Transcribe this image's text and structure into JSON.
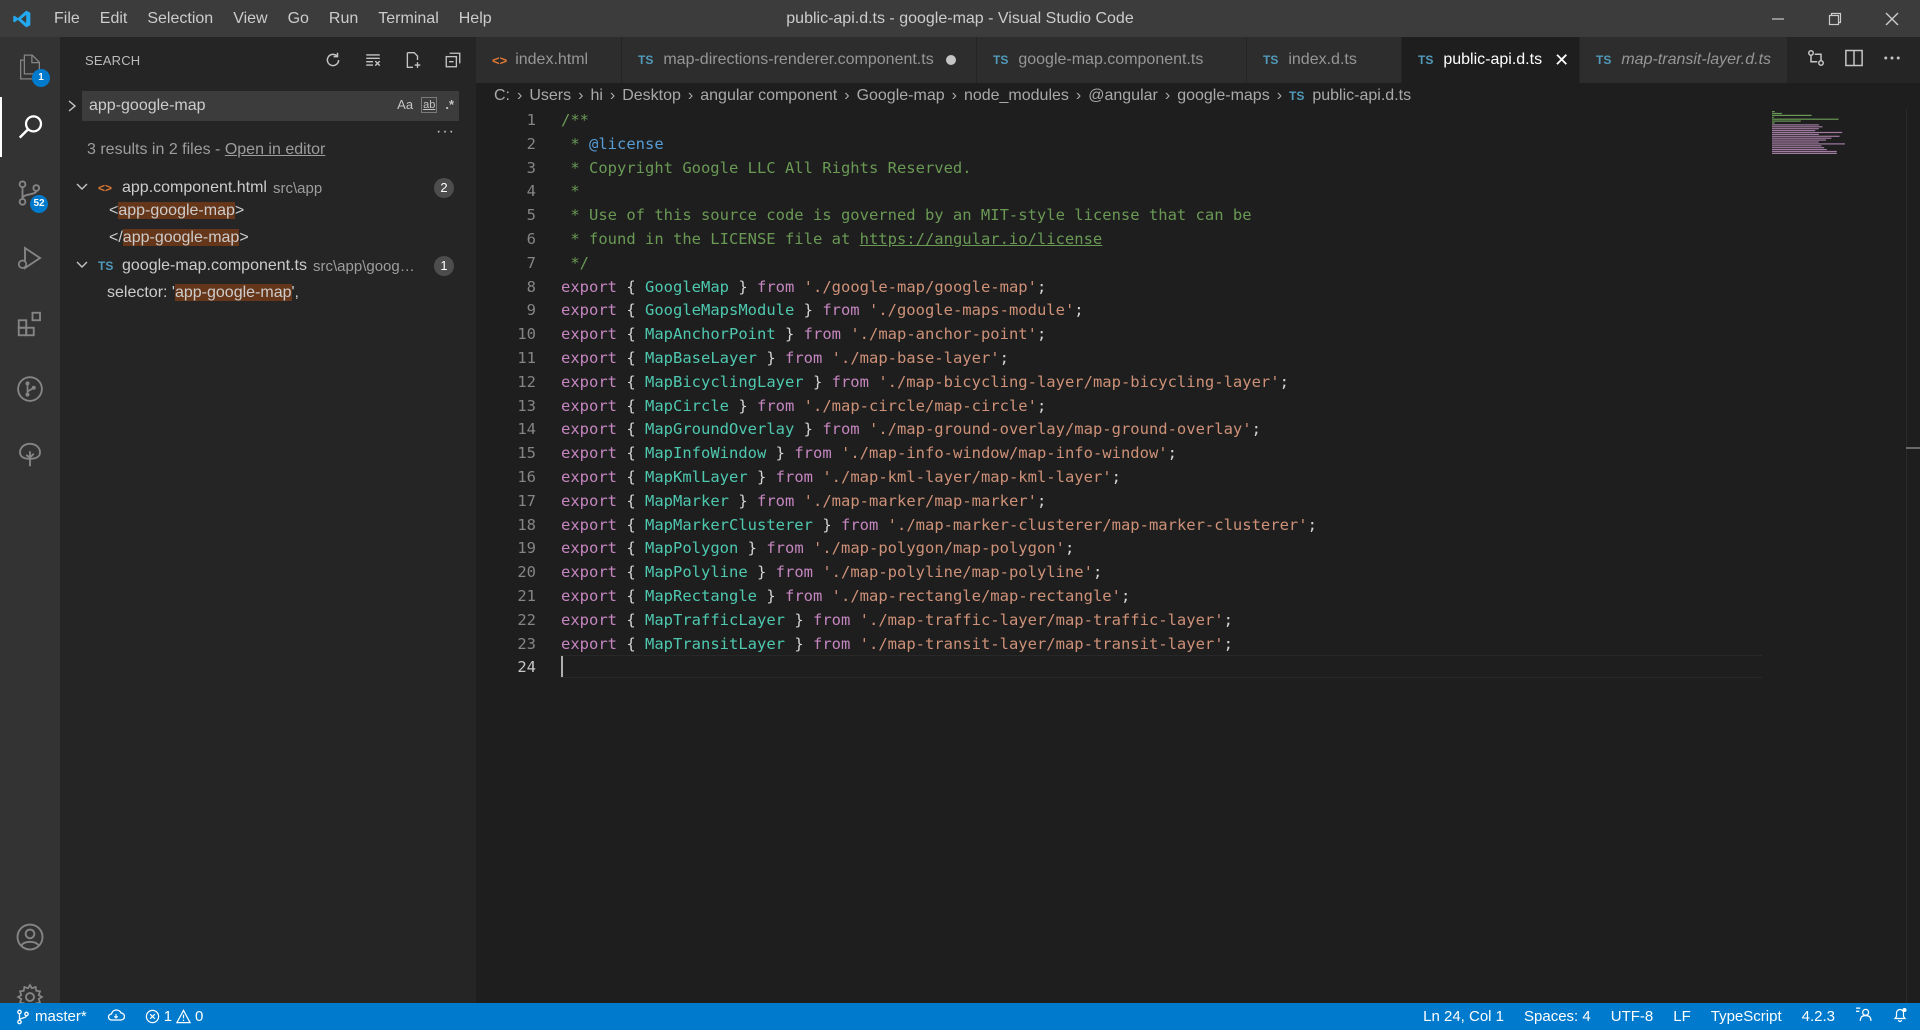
{
  "window": {
    "title": "public-api.d.ts - google-map - Visual Studio Code"
  },
  "menu": [
    "File",
    "Edit",
    "Selection",
    "View",
    "Go",
    "Run",
    "Terminal",
    "Help"
  ],
  "activity_bar": {
    "source_control_badge": "52",
    "explorer_badge": "1"
  },
  "sidebar": {
    "title": "SEARCH",
    "search_value": "app-google-map",
    "options": {
      "match_case": "Aa",
      "whole_word": "ab",
      "regex": ".*"
    },
    "summary_prefix": "3 results in 2 files - ",
    "summary_link": "Open in editor",
    "files": [
      {
        "icon": "<>",
        "name": "app.component.html",
        "path": "src\\app",
        "count": "2",
        "matches": [
          {
            "before": "<",
            "match": "app-google-map",
            "after": ">"
          },
          {
            "before": "</",
            "match": "app-google-map",
            "after": ">"
          }
        ]
      },
      {
        "icon": "TS",
        "name": "google-map.component.ts",
        "path": "src\\app\\google...",
        "count": "1",
        "matches": [
          {
            "before": "selector: '",
            "match": "app-google-map",
            "after": "',"
          }
        ]
      }
    ]
  },
  "tabs": [
    {
      "icon": "<>",
      "label": "index.html",
      "active": false
    },
    {
      "icon": "TS",
      "label": "map-directions-renderer.component.ts",
      "active": false,
      "dirty": true
    },
    {
      "icon": "TS",
      "label": "google-map.component.ts",
      "active": false
    },
    {
      "icon": "TS",
      "label": "index.d.ts",
      "active": false
    },
    {
      "icon": "TS",
      "label": "public-api.d.ts",
      "active": true
    },
    {
      "icon": "TS",
      "label": "map-transit-layer.d.ts",
      "active": false,
      "italic": true
    }
  ],
  "breadcrumb": [
    "C:",
    "Users",
    "hi",
    "Desktop",
    "angular component",
    "Google-map",
    "node_modules",
    "@angular",
    "google-maps"
  ],
  "breadcrumb_file": {
    "icon": "TS",
    "name": "public-api.d.ts"
  },
  "code": {
    "current_line": 24,
    "header": [
      "/**",
      " * @license",
      " * Copyright Google LLC All Rights Reserved.",
      " *",
      " * Use of this source code is governed by an MIT-style license that can be",
      " * found in the LICENSE file at ",
      " */"
    ],
    "license_url": "https://angular.io/license",
    "exports": [
      {
        "name": "GoogleMap",
        "path": "'./google-map/google-map'"
      },
      {
        "name": "GoogleMapsModule",
        "path": "'./google-maps-module'"
      },
      {
        "name": "MapAnchorPoint",
        "path": "'./map-anchor-point'"
      },
      {
        "name": "MapBaseLayer",
        "path": "'./map-base-layer'"
      },
      {
        "name": "MapBicyclingLayer",
        "path": "'./map-bicycling-layer/map-bicycling-layer'"
      },
      {
        "name": "MapCircle",
        "path": "'./map-circle/map-circle'"
      },
      {
        "name": "MapGroundOverlay",
        "path": "'./map-ground-overlay/map-ground-overlay'"
      },
      {
        "name": "MapInfoWindow",
        "path": "'./map-info-window/map-info-window'"
      },
      {
        "name": "MapKmlLayer",
        "path": "'./map-kml-layer/map-kml-layer'"
      },
      {
        "name": "MapMarker",
        "path": "'./map-marker/map-marker'"
      },
      {
        "name": "MapMarkerClusterer",
        "path": "'./map-marker-clusterer/map-marker-clusterer'"
      },
      {
        "name": "MapPolygon",
        "path": "'./map-polygon/map-polygon'"
      },
      {
        "name": "MapPolyline",
        "path": "'./map-polyline/map-polyline'"
      },
      {
        "name": "MapRectangle",
        "path": "'./map-rectangle/map-rectangle'"
      },
      {
        "name": "MapTrafficLayer",
        "path": "'./map-traffic-layer/map-traffic-layer'"
      },
      {
        "name": "MapTransitLayer",
        "path": "'./map-transit-layer/map-transit-layer'"
      }
    ],
    "keywords": {
      "export": "export",
      "from": "from"
    }
  },
  "statusbar": {
    "branch": "master*",
    "errors": "1",
    "warnings": "0",
    "position": "Ln 24, Col 1",
    "spaces": "Spaces: 4",
    "encoding": "UTF-8",
    "eol": "LF",
    "language": "TypeScript",
    "version": "4.2.3"
  },
  "colors": {
    "accent": "#007acc",
    "comment": "#6a9955",
    "keyword": "#c586c0",
    "identifier": "#4ec9b0",
    "string": "#ce9178"
  }
}
